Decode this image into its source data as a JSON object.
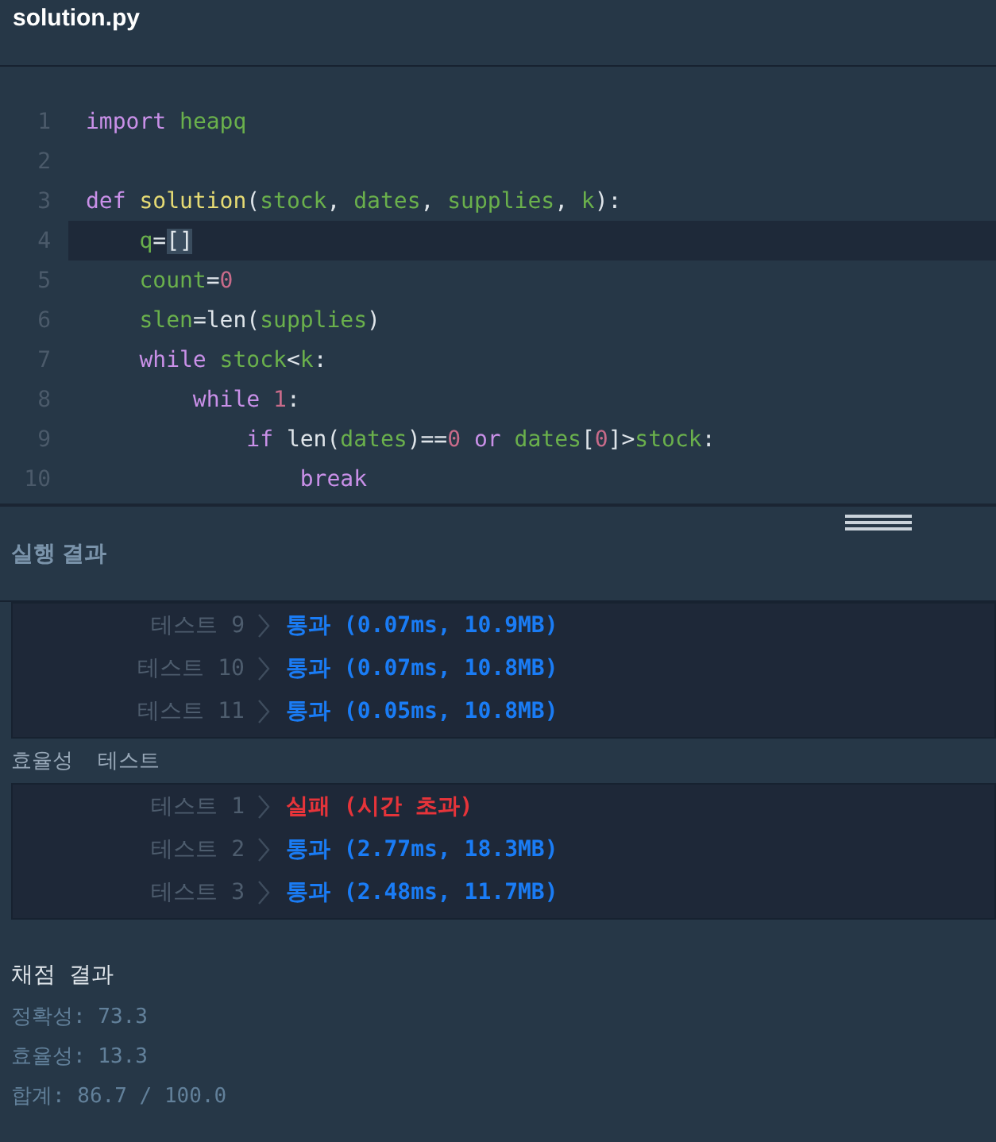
{
  "file_tab": {
    "title": "solution.py"
  },
  "code": [
    {
      "number": "1",
      "current": false,
      "tokens": [
        {
          "text": "import ",
          "kind": "kw"
        },
        {
          "text": "heapq",
          "kind": "id"
        }
      ]
    },
    {
      "number": "2",
      "current": false
    },
    {
      "number": "3",
      "current": false,
      "tokens": [
        {
          "text": "def ",
          "kind": "kw"
        },
        {
          "text": "solution",
          "kind": "fn"
        },
        {
          "text": "(",
          "kind": "op"
        },
        {
          "text": "stock",
          "kind": "id"
        },
        {
          "text": ", ",
          "kind": "op"
        },
        {
          "text": "dates",
          "kind": "id"
        },
        {
          "text": ", ",
          "kind": "op"
        },
        {
          "text": "supplies",
          "kind": "id"
        },
        {
          "text": ", ",
          "kind": "op"
        },
        {
          "text": "k",
          "kind": "id"
        },
        {
          "text": "):",
          "kind": "op"
        }
      ]
    },
    {
      "number": "4",
      "current": true,
      "tokens": [
        {
          "text": "    q",
          "kind": "id"
        },
        {
          "text": "=",
          "kind": "op"
        },
        {
          "text": "[]",
          "kind": "bracket"
        }
      ]
    },
    {
      "number": "5",
      "current": false,
      "tokens": [
        {
          "text": "    count",
          "kind": "id"
        },
        {
          "text": "=",
          "kind": "op"
        },
        {
          "text": "0",
          "kind": "num"
        }
      ]
    },
    {
      "number": "6",
      "current": false,
      "tokens": [
        {
          "text": "    slen",
          "kind": "id"
        },
        {
          "text": "=len(",
          "kind": "op"
        },
        {
          "text": "supplies",
          "kind": "id"
        },
        {
          "text": ")",
          "kind": "op"
        }
      ]
    },
    {
      "number": "7",
      "current": false,
      "tokens": [
        {
          "text": "    while ",
          "kind": "kw"
        },
        {
          "text": "stock",
          "kind": "id"
        },
        {
          "text": "<",
          "kind": "op"
        },
        {
          "text": "k",
          "kind": "id"
        },
        {
          "text": ":",
          "kind": "op"
        }
      ]
    },
    {
      "number": "8",
      "current": false,
      "tokens": [
        {
          "text": "        while ",
          "kind": "kw"
        },
        {
          "text": "1",
          "kind": "num"
        },
        {
          "text": ":",
          "kind": "op"
        }
      ]
    },
    {
      "number": "9",
      "current": false,
      "tokens": [
        {
          "text": "            if",
          "kind": "kw"
        },
        {
          "text": " len(",
          "kind": "op"
        },
        {
          "text": "dates",
          "kind": "id"
        },
        {
          "text": ")==",
          "kind": "op"
        },
        {
          "text": "0",
          "kind": "num"
        },
        {
          "text": " or ",
          "kind": "kw"
        },
        {
          "text": "dates",
          "kind": "id"
        },
        {
          "text": "[",
          "kind": "op"
        },
        {
          "text": "0",
          "kind": "num"
        },
        {
          "text": "]>",
          "kind": "op"
        },
        {
          "text": "stock",
          "kind": "id"
        },
        {
          "text": ":",
          "kind": "op"
        }
      ]
    },
    {
      "number": "10",
      "current": false,
      "tokens": [
        {
          "text": "                break",
          "kind": "kw"
        }
      ]
    }
  ],
  "results_panel": {
    "title": "실행 결과",
    "groups": [
      {
        "rows": [
          {
            "label": "테스트 9",
            "failed": false,
            "result": "통과 (0.07ms, 10.9MB)"
          },
          {
            "label": "테스트 10",
            "failed": false,
            "result": "통과 (0.07ms, 10.8MB)"
          },
          {
            "label": "테스트 11",
            "failed": false,
            "result": "통과 (0.05ms, 10.8MB)"
          }
        ]
      },
      {
        "heading": "효율성  테스트",
        "rows": [
          {
            "label": "테스트 1",
            "failed": true,
            "result": "실패 (시간 초과)"
          },
          {
            "label": "테스트 2",
            "failed": false,
            "result": "통과 (2.77ms, 18.3MB)"
          },
          {
            "label": "테스트 3",
            "failed": false,
            "result": "통과 (2.48ms, 11.7MB)"
          }
        ]
      }
    ],
    "score": {
      "title": "채점 결과",
      "lines": [
        "정확성: 73.3",
        "효율성: 13.3",
        "합계: 86.7 / 100.0"
      ]
    }
  }
}
